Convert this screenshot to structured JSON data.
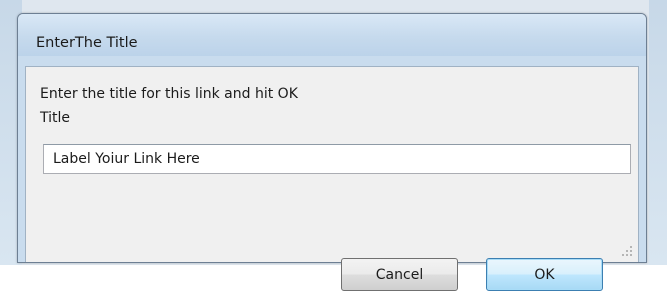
{
  "dialog": {
    "title": "EnterThe Title",
    "prompt": "Enter the title for this link and hit OK",
    "field_label": "Title",
    "input_value": "Label Yoiur Link Here",
    "buttons": {
      "cancel_label": "Cancel",
      "ok_label": "OK"
    }
  },
  "icons": [
    "resize-grip-icon"
  ],
  "colors": {
    "titlebar": "#c6daed",
    "client_background": "#f0f0f0",
    "default_button_border": "#3c7fb1",
    "default_button_fill": "#bee6fd"
  }
}
